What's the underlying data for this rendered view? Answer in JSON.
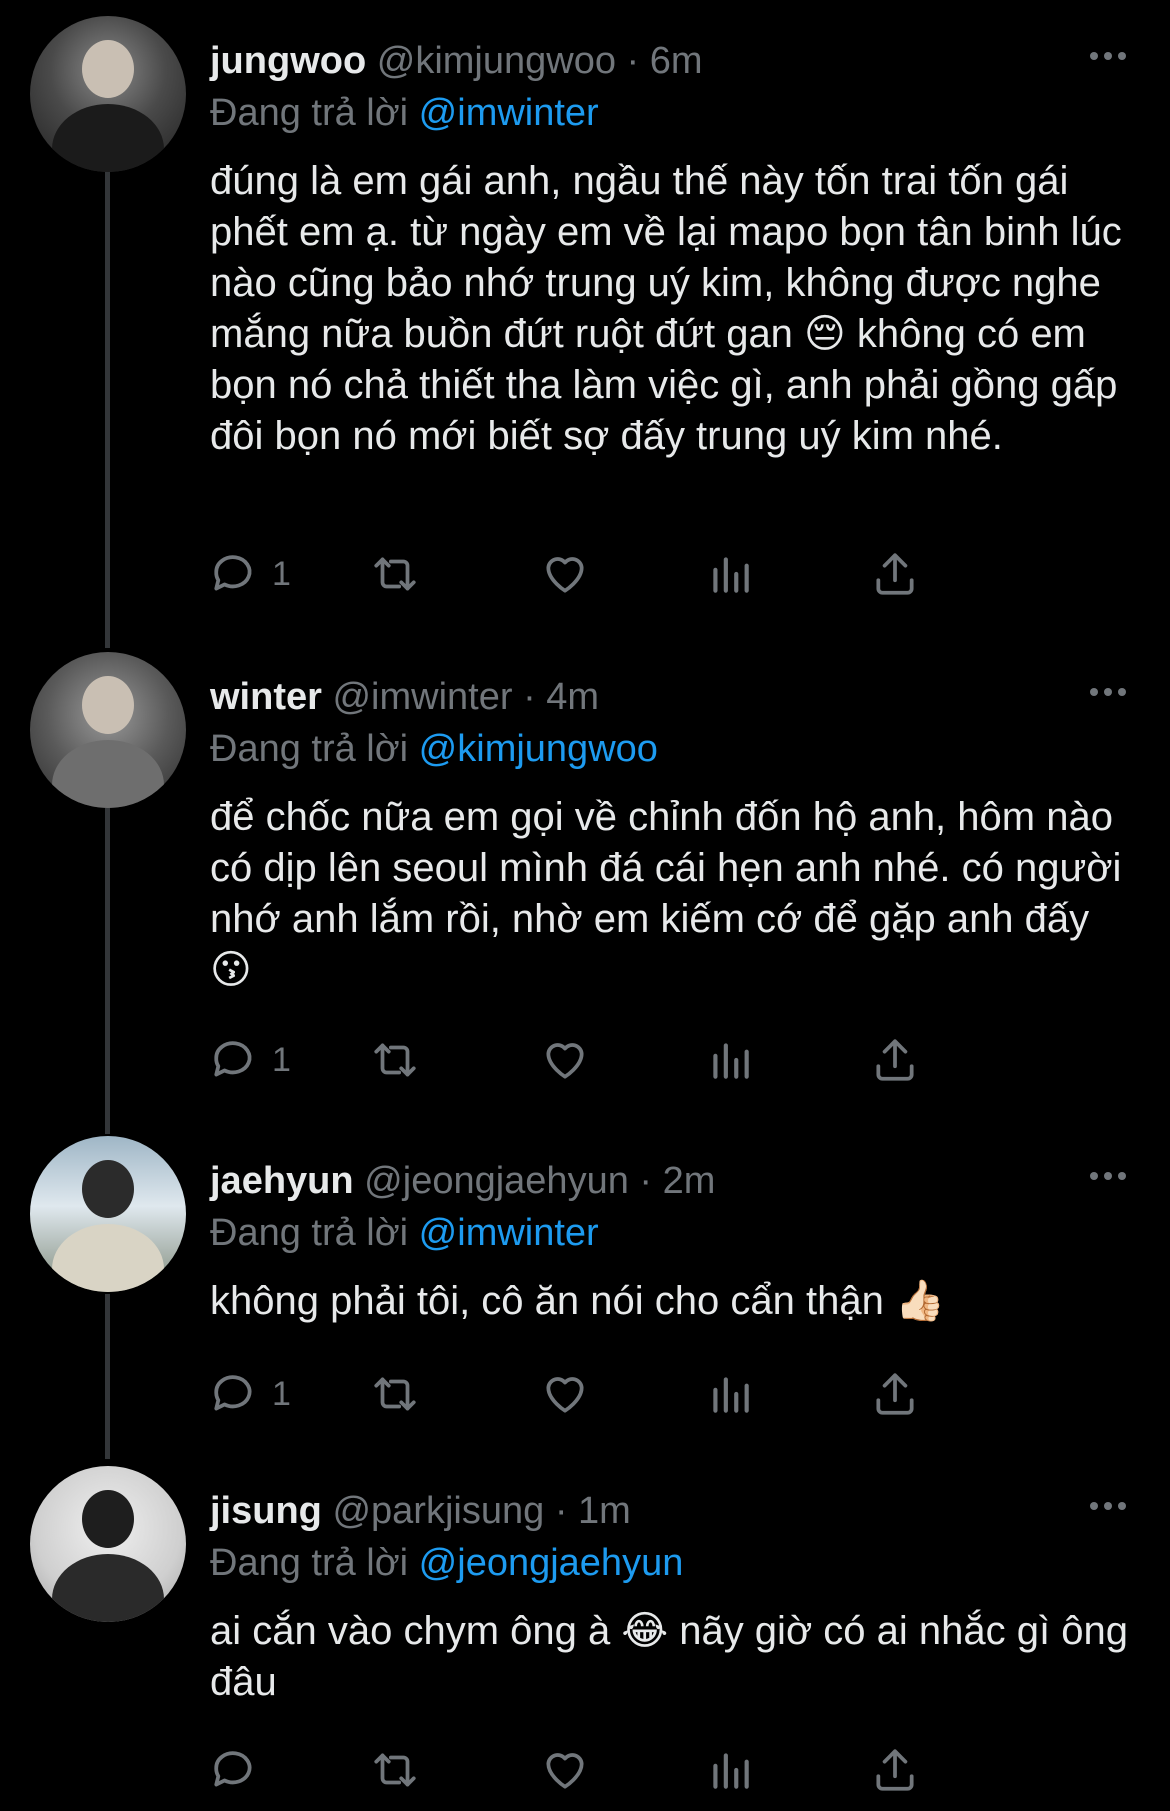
{
  "tweets": [
    {
      "name": "jungwoo",
      "handle": "@kimjungwoo",
      "dot": "·",
      "time": "6m",
      "reply_prefix": "Đang trả lời",
      "reply_to": "@imwinter",
      "text": "đúng là em gái anh, ngầu thế này tốn trai tốn gái phết em ạ. từ ngày em về lại mapo bọn tân binh lúc nào cũng bảo nhớ trung uý kim, không được nghe mắng nữa buồn đứt ruột đứt gan 😔  không có em bọn nó chả thiết tha làm việc gì, anh phải gồng gấp đôi bọn nó mới biết sợ đấy trung uý kim nhé.",
      "reply_count": "1",
      "icons": [
        "reply-icon",
        "retweet-icon",
        "like-icon",
        "analytics-icon",
        "share-icon"
      ]
    },
    {
      "name": "winter",
      "handle": "@imwinter",
      "dot": "·",
      "time": "4m",
      "reply_prefix": "Đang trả lời",
      "reply_to": "@kimjungwoo",
      "text": "để chốc nữa em gọi về chỉnh đốn hộ anh, hôm nào có dịp lên seoul mình đá cái hẹn anh nhé. có người nhớ anh lắm rồi, nhờ em kiếm cớ để gặp anh đấy 😗",
      "reply_count": "1",
      "icons": [
        "reply-icon",
        "retweet-icon",
        "like-icon",
        "analytics-icon",
        "share-icon"
      ]
    },
    {
      "name": "jaehyun",
      "handle": "@jeongjaehyun",
      "dot": "·",
      "time": "2m",
      "reply_prefix": "Đang trả lời",
      "reply_to": "@imwinter",
      "text": "không phải tôi, cô ăn nói cho cẩn thận 👍🏻",
      "reply_count": "1",
      "icons": [
        "reply-icon",
        "retweet-icon",
        "like-icon",
        "analytics-icon",
        "share-icon"
      ]
    },
    {
      "name": "jisung",
      "handle": "@parkjisung",
      "dot": "·",
      "time": "1m",
      "reply_prefix": "Đang trả lời",
      "reply_to": "@jeongjaehyun",
      "text": "ai cắn vào chym ông à 😂  nãy giờ có ai nhắc gì ông đâu",
      "reply_count": "",
      "icons": [
        "reply-icon",
        "retweet-icon",
        "like-icon",
        "analytics-icon",
        "share-icon"
      ]
    }
  ],
  "colors": {
    "background": "#000000",
    "text": "#e7e9ea",
    "muted": "#71767b",
    "link": "#1d9bf0",
    "thread_line": "#333639"
  }
}
